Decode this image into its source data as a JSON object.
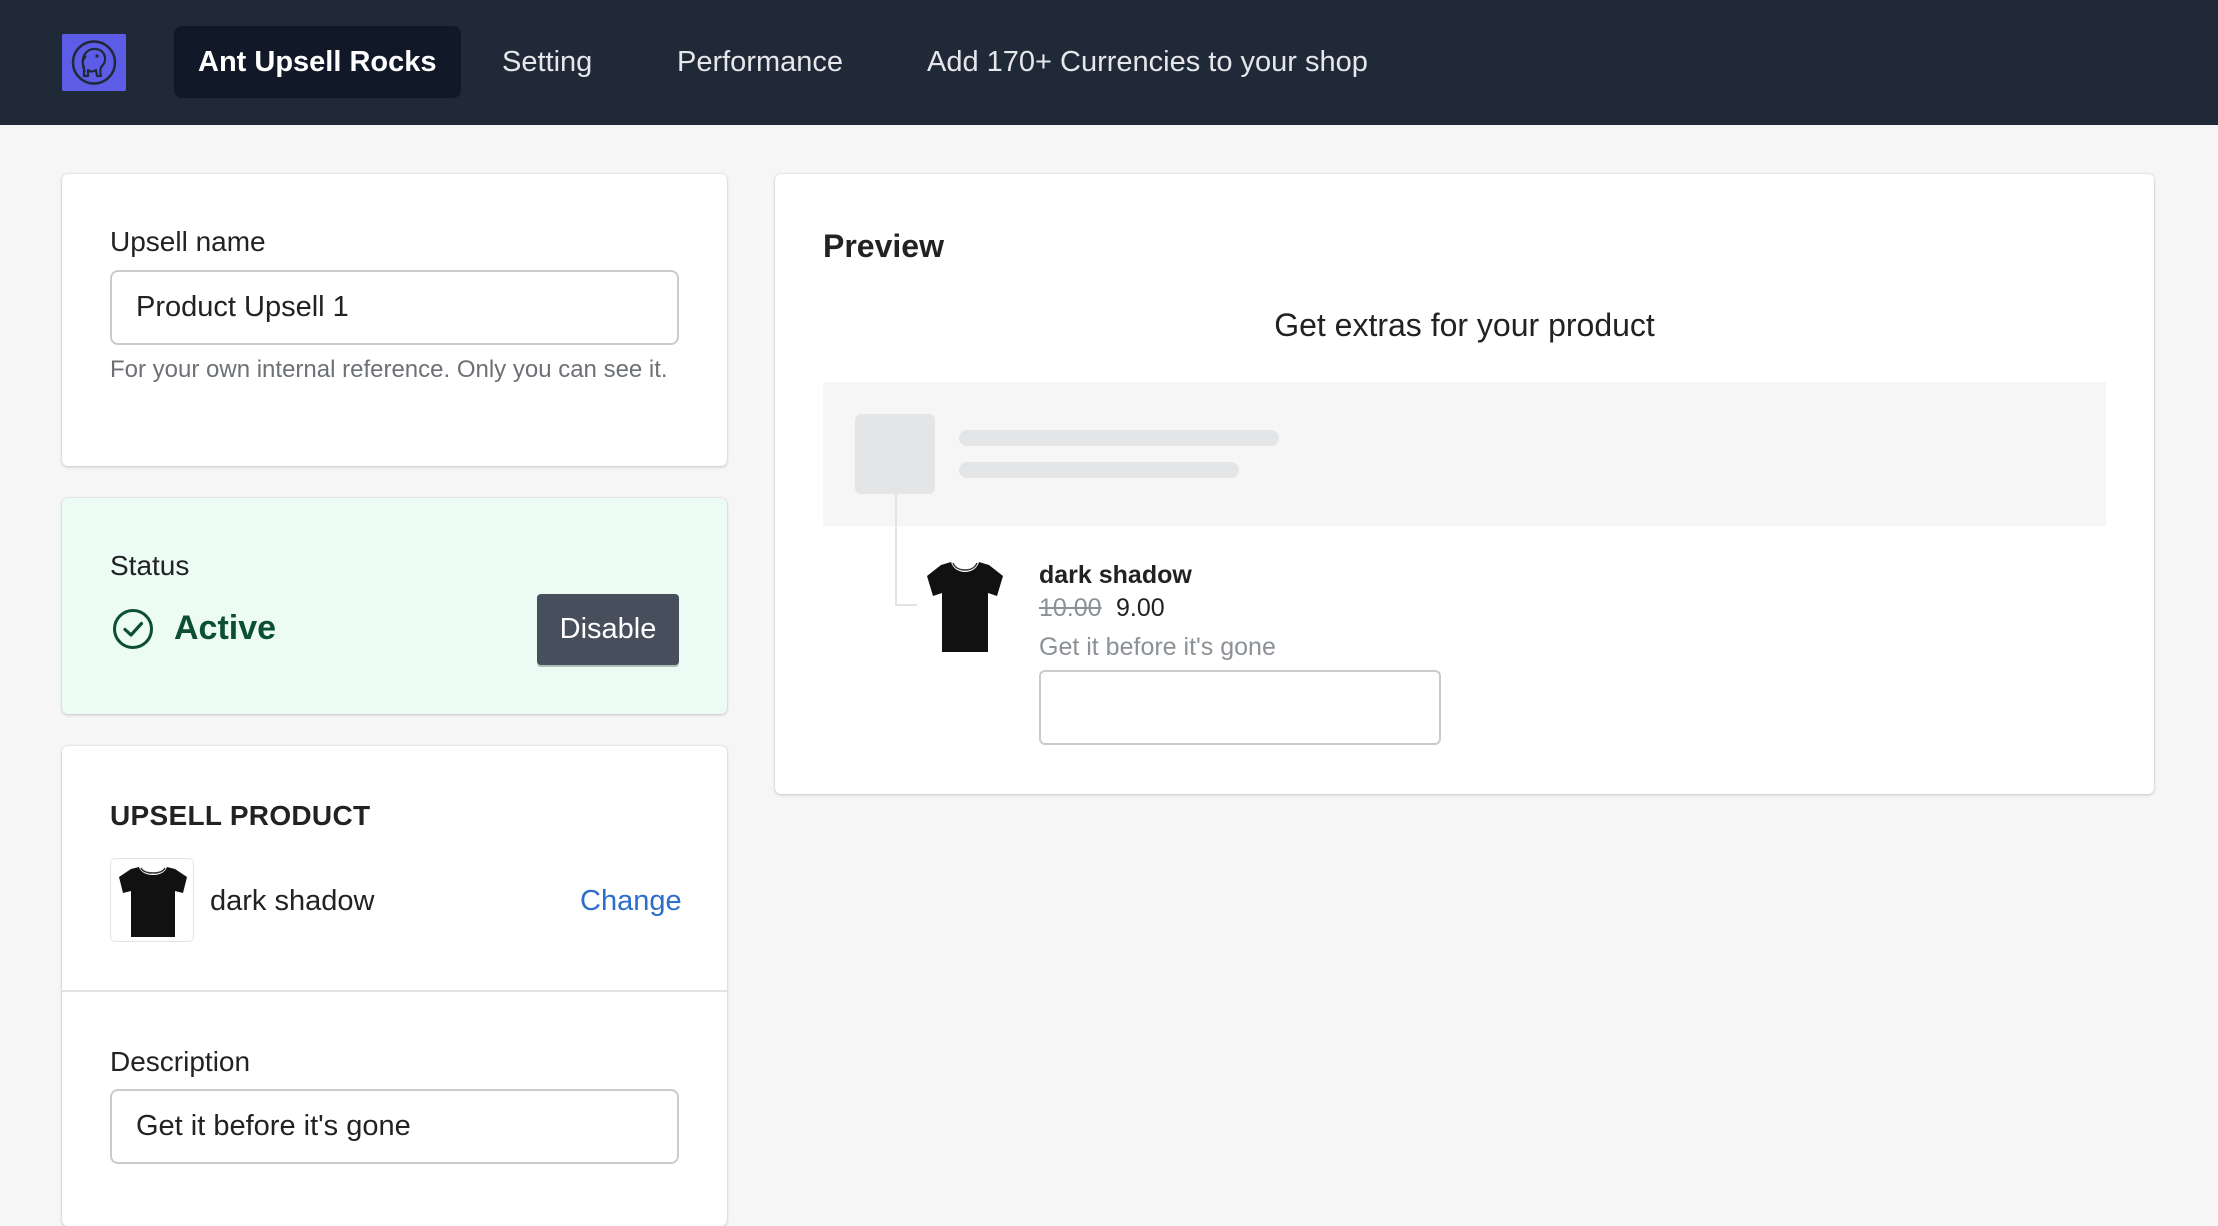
{
  "nav": {
    "logo_icon": "elephant-logo-icon",
    "items": [
      {
        "label": "Ant Upsell Rocks",
        "active": true
      },
      {
        "label": "Setting",
        "active": false
      },
      {
        "label": "Performance",
        "active": false
      },
      {
        "label": "Add 170+ Currencies to your shop",
        "active": false
      }
    ]
  },
  "upsell_name": {
    "label": "Upsell name",
    "value": "Product Upsell 1",
    "help": "For your own internal reference. Only you can see it."
  },
  "status": {
    "label": "Status",
    "value": "Active",
    "icon": "check-circle-icon",
    "button_label": "Disable"
  },
  "upsell_product": {
    "title": "UPSELL PRODUCT",
    "product_name": "dark shadow",
    "product_icon": "tshirt-icon",
    "change_label": "Change"
  },
  "description": {
    "label": "Description",
    "value": "Get it before it's gone"
  },
  "preview": {
    "title": "Preview",
    "heading": "Get extras for your product",
    "product_name": "dark shadow",
    "old_price": "10.00",
    "new_price": "9.00",
    "description": "Get it before it's gone"
  },
  "colors": {
    "nav_bg": "#1f2937",
    "accent": "#5c5ce6",
    "status_bg": "#ecfbf3",
    "status_text": "#0d4f35",
    "link": "#2c6ecb"
  }
}
